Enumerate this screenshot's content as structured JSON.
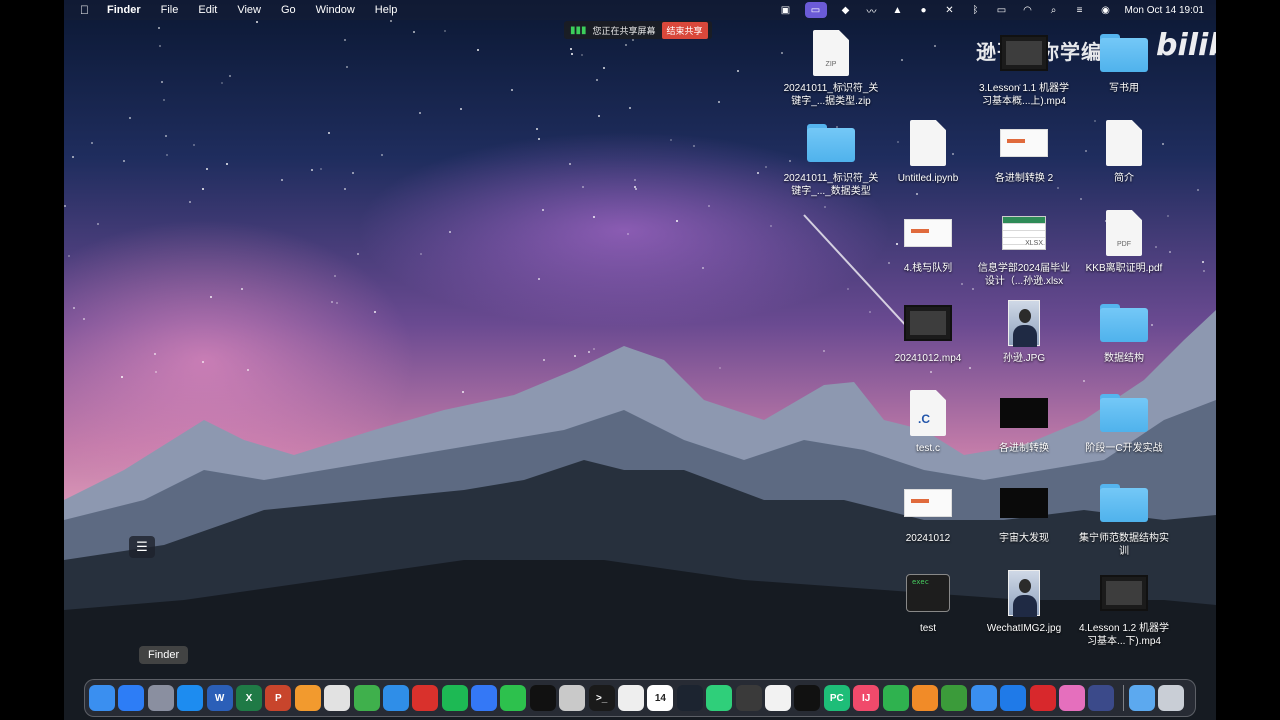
{
  "menubar": {
    "app_name": "Finder",
    "items": [
      "File",
      "Edit",
      "View",
      "Go",
      "Window",
      "Help"
    ],
    "clock": "Mon Oct 14  19:01"
  },
  "share_banner": {
    "text": "您正在共享屏幕",
    "stop_label": "结束共享"
  },
  "watermark": {
    "channel": "逊哥带你学编程",
    "site": "bilibili"
  },
  "desktop_icons": [
    {
      "label": "20241011_标识符_关键字_...据类型.zip",
      "kind": "zip"
    },
    {
      "label": "3.Lesson 1.1 机器学习基本概...上).mp4",
      "kind": "video"
    },
    {
      "label": "写书用",
      "kind": "folder"
    },
    {
      "label": "20241011_标识符_关键字_..._数据类型",
      "kind": "folder"
    },
    {
      "label": "Untitled.ipynb",
      "kind": "doc"
    },
    {
      "label": "各进制转换 2",
      "kind": "slide"
    },
    {
      "label": "简介",
      "kind": "doc"
    },
    {
      "label": "4.栈与队列",
      "kind": "slide"
    },
    {
      "label": "信息学部2024届毕业设计（...孙逊.xlsx",
      "kind": "xlsx"
    },
    {
      "label": "KKB离职证明.pdf",
      "kind": "pdf"
    },
    {
      "label": "20241012.mp4",
      "kind": "video"
    },
    {
      "label": "孙逊.JPG",
      "kind": "photo"
    },
    {
      "label": "数据结构",
      "kind": "folder"
    },
    {
      "label": "test.c",
      "kind": "c"
    },
    {
      "label": "各进制转换",
      "kind": "dark"
    },
    {
      "label": "阶段一C开发实战",
      "kind": "folder"
    },
    {
      "label": "20241012",
      "kind": "slide"
    },
    {
      "label": "宇宙大发现",
      "kind": "dark"
    },
    {
      "label": "集宁师范数据结构实训",
      "kind": "folder"
    },
    {
      "label": "test",
      "kind": "exec"
    },
    {
      "label": "WechatIMG2.jpg",
      "kind": "photo"
    },
    {
      "label": "4.Lesson 1.2 机器学习基本...下).mp4",
      "kind": "video"
    }
  ],
  "thumb_tags": {
    "zip": "ZIP",
    "xlsx": "XLSX",
    "pdf": "PDF",
    "c": ".C",
    "exec": "exec"
  },
  "tooltip": "Finder",
  "dock": {
    "apps": [
      {
        "name": "finder-icon",
        "color": "#3a8ff0"
      },
      {
        "name": "app-store-icon",
        "color": "#2d7df6"
      },
      {
        "name": "launchpad-icon",
        "color": "#8a8fa0"
      },
      {
        "name": "safari-icon",
        "color": "#1d8cf0"
      },
      {
        "name": "word-icon",
        "color": "#2b5fb8"
      },
      {
        "name": "excel-icon",
        "color": "#1f7a46"
      },
      {
        "name": "powerpoint-icon",
        "color": "#c8452c"
      },
      {
        "name": "pages-icon",
        "color": "#f29a2e"
      },
      {
        "name": "chrome-icon",
        "color": "#e2e2e2"
      },
      {
        "name": "numbers-icon",
        "color": "#3fb04c"
      },
      {
        "name": "keynote-icon",
        "color": "#2f8ee8"
      },
      {
        "name": "netease-music-icon",
        "color": "#d9312c"
      },
      {
        "name": "spotify-icon",
        "color": "#1db954"
      },
      {
        "name": "feishu-icon",
        "color": "#3478f6"
      },
      {
        "name": "wechat-icon",
        "color": "#2dc14d"
      },
      {
        "name": "qq-icon",
        "color": "#111111"
      },
      {
        "name": "utility-icon",
        "color": "#c9c9c9"
      },
      {
        "name": "terminal-icon",
        "color": "#1a1a1a"
      },
      {
        "name": "preview-icon",
        "color": "#eeeeee"
      },
      {
        "name": "calendar-icon",
        "color": "#ffffff"
      },
      {
        "name": "screen-time-icon",
        "color": "#1c2430"
      },
      {
        "name": "xmind-icon",
        "color": "#2fcf7a"
      },
      {
        "name": "evernote-icon",
        "color": "#3a3a3a"
      },
      {
        "name": "paperclip-icon",
        "color": "#f2f2f2"
      },
      {
        "name": "capcut-icon",
        "color": "#111111"
      },
      {
        "name": "pycharm-icon",
        "color": "#1ebd78"
      },
      {
        "name": "intellij-icon",
        "color": "#f04a6b"
      },
      {
        "name": "recording-icon",
        "color": "#2fb24f"
      },
      {
        "name": "sublime-icon",
        "color": "#f18b28"
      },
      {
        "name": "anaconda-icon",
        "color": "#3b9b3a"
      },
      {
        "name": "swift-icon",
        "color": "#3a8ff0"
      },
      {
        "name": "notes-app-icon",
        "color": "#1f7ae8"
      },
      {
        "name": "acrobat-icon",
        "color": "#d8282c"
      },
      {
        "name": "cleaner-icon",
        "color": "#e56fbd"
      },
      {
        "name": "docker-icon",
        "color": "#3b4a8a"
      },
      {
        "name": "downloads-icon",
        "color": "#5ca9ef"
      },
      {
        "name": "trash-icon",
        "color": "#c9ced6"
      }
    ],
    "glyphs": {
      "word-icon": "W",
      "excel-icon": "X",
      "powerpoint-icon": "P",
      "pycharm-icon": "PC",
      "intellij-icon": "IJ",
      "calendar-icon": "14",
      "terminal-icon": ">_"
    }
  }
}
